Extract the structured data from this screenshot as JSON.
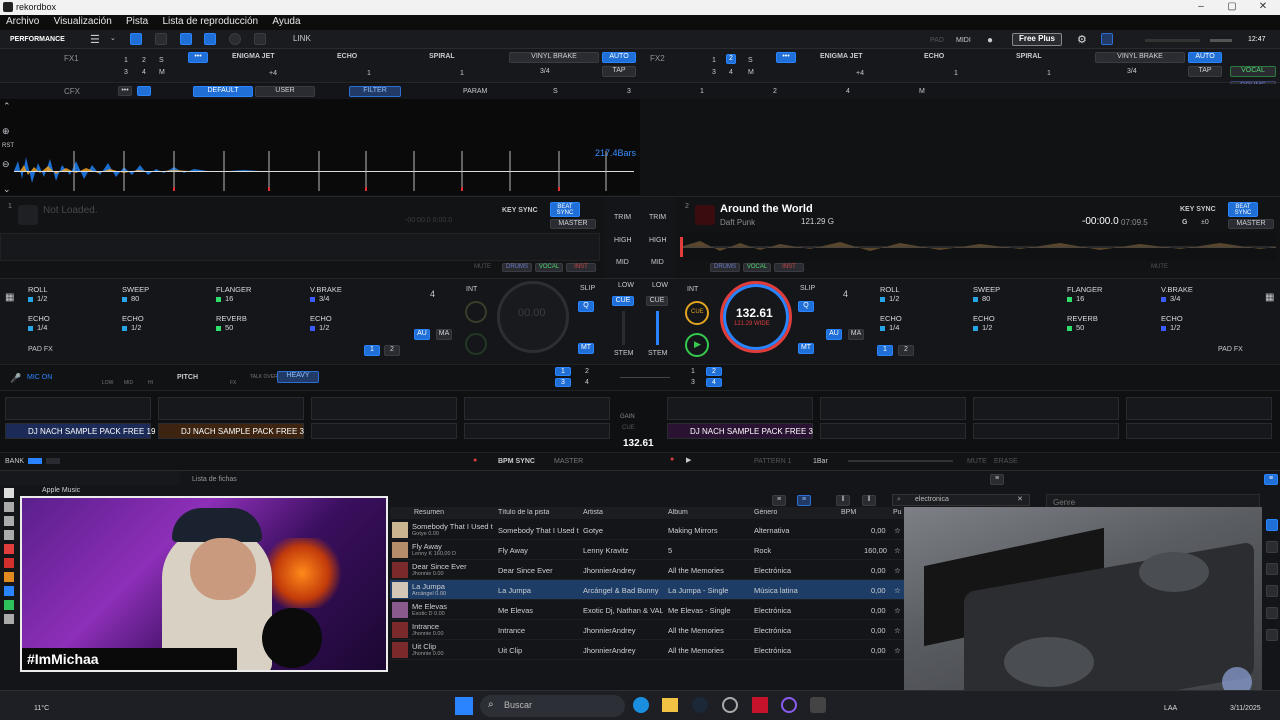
{
  "window": {
    "title": "rekordbox"
  },
  "menu": [
    "Archivo",
    "Visualización",
    "Pista",
    "Lista de reproducción",
    "Ayuda"
  ],
  "toolbar": {
    "mode": "PERFORMANCE",
    "link": "LINK",
    "pad": "PAD",
    "midi": "MIDI",
    "plan": "Free Plus",
    "clock": "12:47"
  },
  "fx1": {
    "label": "FX1",
    "effects": [
      "ENIGMA JET",
      "ECHO",
      "SPIRAL"
    ],
    "vinyl": "VINYL BRAKE",
    "auto": "AUTO",
    "tap": "TAP",
    "beats": [
      "1",
      "2",
      "S",
      "3",
      "4",
      "M"
    ],
    "amount": [
      "+4",
      "1",
      "1",
      "3/4"
    ]
  },
  "fx2": {
    "label": "FX2",
    "effects": [
      "ENIGMA JET",
      "ECHO",
      "SPIRAL"
    ],
    "vinyl": "VINYL BRAKE",
    "auto": "AUTO",
    "tap": "TAP",
    "vocal": "VOCAL",
    "drums": "DRUMS",
    "beats": [
      "1",
      "2",
      "S",
      "3",
      "4",
      "M"
    ],
    "amount": [
      "+4",
      "1",
      "1",
      "3/4"
    ]
  },
  "cfx": {
    "label": "CFX",
    "default": "DEFAULT",
    "user": "USER",
    "filter": "FILTER",
    "param": "PARAM",
    "params": [
      "S",
      "3",
      "1",
      "2",
      "4",
      "M"
    ]
  },
  "waveform": {
    "bars": "217.4Bars",
    "rst": "RST"
  },
  "deck1": {
    "num": "1",
    "status": "Not Loaded.",
    "time": "-00:00.0  0:00.0",
    "key_sync": "KEY SYNC",
    "beat_sync": "BEAT SYNC",
    "master": "MASTER",
    "mute": "MUTE",
    "drums": "DRUMS",
    "vocal": "VOCAL",
    "inst": "INST",
    "bpm": "00.00",
    "beat": "4",
    "int": "INT",
    "slip": "SLIP",
    "cue": "CUE",
    "q": "Q",
    "au": "AU",
    "ma": "MA",
    "mt": "MT"
  },
  "deck2": {
    "num": "2",
    "title": "Around the World",
    "artist": "Daft Punk",
    "bpm_key": "121.29 G",
    "time": "-00:00.0",
    "total": "07:09.5",
    "key_sync": "KEY SYNC",
    "beat_sync": "BEAT SYNC",
    "master": "MASTER",
    "key": "G",
    "key_offset": "±0",
    "mute": "MUTE",
    "drums": "DRUMS",
    "vocal": "VOCAL",
    "inst": "INST",
    "bpm": "132.61",
    "bpm_sub": "121.29 WIDE",
    "beat": "4",
    "int": "INT",
    "slip": "SLIP",
    "cue": "CUE",
    "q": "Q",
    "au": "AU",
    "ma": "MA",
    "mt": "MT"
  },
  "mixer": {
    "trim": "TRIM",
    "high": "HIGH",
    "mid": "MID",
    "low": "LOW",
    "cue": "CUE",
    "stem": "STEM"
  },
  "pads_left": [
    {
      "name": "ROLL",
      "val": "1/2",
      "color": "#27a5e6"
    },
    {
      "name": "SWEEP",
      "val": "80",
      "color": "#27a5e6"
    },
    {
      "name": "FLANGER",
      "val": "16",
      "color": "#2ee06b"
    },
    {
      "name": "V.BRAKE",
      "val": "3/4",
      "color": "#3b5bff"
    },
    {
      "name": "ECHO",
      "val": "1/4",
      "color": "#27a5e6"
    },
    {
      "name": "ECHO",
      "val": "1/2",
      "color": "#27a5e6"
    },
    {
      "name": "REVERB",
      "val": "50",
      "color": "#2ee06b"
    },
    {
      "name": "ECHO",
      "val": "1/2",
      "color": "#3b5bff"
    }
  ],
  "pads_right": [
    {
      "name": "ROLL",
      "val": "1/2",
      "color": "#27a5e6"
    },
    {
      "name": "SWEEP",
      "val": "80",
      "color": "#27a5e6"
    },
    {
      "name": "FLANGER",
      "val": "16",
      "color": "#2ee06b"
    },
    {
      "name": "V.BRAKE",
      "val": "3/4",
      "color": "#3b5bff"
    },
    {
      "name": "ECHO",
      "val": "1/4",
      "color": "#27a5e6"
    },
    {
      "name": "ECHO",
      "val": "1/2",
      "color": "#27a5e6"
    },
    {
      "name": "REVERB",
      "val": "50",
      "color": "#2ee06b"
    },
    {
      "name": "ECHO",
      "val": "1/2",
      "color": "#3b5bff"
    }
  ],
  "padfx": "PAD FX",
  "mic": {
    "on": "MIC ON",
    "low": "LOW",
    "mid": "MID",
    "hi": "HI",
    "pitch": "PITCH",
    "fx": "FX",
    "talkover": "TALK OVER",
    "heavy": "HEAVY"
  },
  "sampler": {
    "slot1": "DJ NACH SAMPLE PACK FREE 19",
    "slot2": "DJ NACH SAMPLE PACK FREE 3",
    "slot3": "DJ NACH SAMPLE PACK FREE 3",
    "gain": "GAIN",
    "cue": "CUE",
    "bpm": "132.61"
  },
  "bank": {
    "label": "BANK",
    "bpm_sync": "BPM SYNC",
    "master": "MASTER",
    "pattern": "PATTERN 1",
    "bar": "1Bar",
    "mute": "MUTE",
    "erase": "ERASE"
  },
  "browser": {
    "tree_item": "Apple Music",
    "fichas": "Lista de fichas",
    "search": "electronica",
    "genre_filter": "Genre",
    "columns": [
      "Resumen",
      "Título de la pista",
      "Artista",
      "Álbum",
      "Género",
      "BPM",
      "Pu"
    ],
    "rows": [
      {
        "summary": "Somebody That I Used t",
        "sub": "Gotye  0.00",
        "title": "Somebody That I Used t",
        "artist": "Gotye",
        "album": "Making Mirrors",
        "genre": "Alternativa",
        "bpm": "0,00",
        "thumb": "#c9b590"
      },
      {
        "summary": "Fly Away",
        "sub": "Lenny K  160,00  D",
        "title": "Fly Away",
        "artist": "Lenny Kravitz",
        "album": "5",
        "genre": "Rock",
        "bpm": "160,00",
        "thumb": "#b58d6b"
      },
      {
        "summary": "Dear Since Ever",
        "sub": "Jhonnie  0.00",
        "title": "Dear Since Ever",
        "artist": "JhonnierAndrey",
        "album": "All the Memories",
        "genre": "Electrónica",
        "bpm": "0,00",
        "thumb": "#7a2a2a"
      },
      {
        "summary": "La Jumpa",
        "sub": "Arcángel  0.00",
        "title": "La Jumpa",
        "artist": "Arcángel & Bad Bunny",
        "album": "La Jumpa - Single",
        "genre": "Música latina",
        "bpm": "0,00",
        "thumb": "#d4c7b8"
      },
      {
        "summary": "Me Elevas",
        "sub": "Exotic D  0.00",
        "title": "Me Elevas",
        "artist": "Exotic Dj, Nathan & VAL",
        "album": "Me Elevas - Single",
        "genre": "Electrónica",
        "bpm": "0,00",
        "thumb": "#8b5a8c"
      },
      {
        "summary": "Intrance",
        "sub": "Jhonnie  0.00",
        "title": "Intrance",
        "artist": "JhonnierAndrey",
        "album": "All the Memories",
        "genre": "Electrónica",
        "bpm": "0,00",
        "thumb": "#7a2a2a"
      },
      {
        "summary": "Uit Clip",
        "sub": "Jhonnie  0.00",
        "title": "Uit Clip",
        "artist": "JhonnierAndrey",
        "album": "All the Memories",
        "genre": "Electrónica",
        "bpm": "0,00",
        "thumb": "#7a2a2a"
      }
    ]
  },
  "stream": {
    "handle": "#ImMichaa"
  },
  "taskbar": {
    "temp": "11°C",
    "search": "Buscar",
    "lang": "LAA",
    "date": "3/11/2025"
  },
  "colors": {
    "accent": "#2b84ff",
    "wave": "#1a6fd1",
    "deck2_ring": "#e23d3d"
  }
}
